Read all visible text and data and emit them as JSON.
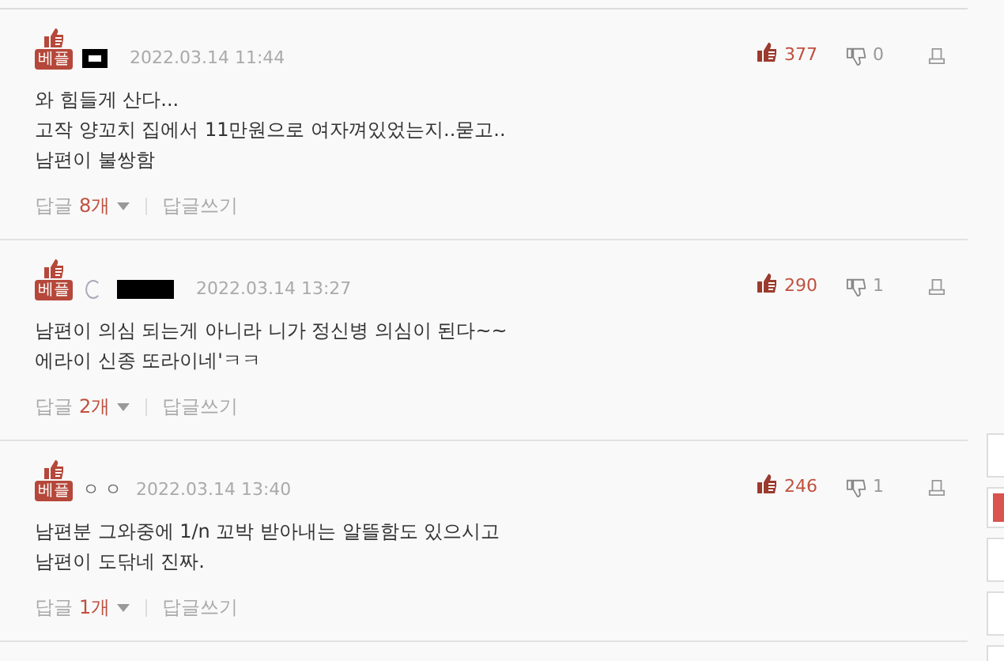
{
  "comments": [
    {
      "badge": "베플",
      "author": {
        "kind": "mask"
      },
      "date": "2022.03.14 11:44",
      "lines": [
        "와 힘들게 산다...",
        "고작 양꼬치 집에서 11만원으로 여자껴있었는지..묻고..",
        "남편이 불쌍함"
      ],
      "likes": "377",
      "dislikes": "0",
      "reply_label": "답글",
      "reply_count": "8개",
      "write_reply": "답글쓰기"
    },
    {
      "badge": "베플",
      "author": {
        "kind": "profile"
      },
      "date": "2022.03.14 13:27",
      "lines": [
        "남편이 의심 되는게 아니라 니가 정신병 의심이 된다~~",
        "에라이 신종 또라이네'ㅋㅋ"
      ],
      "likes": "290",
      "dislikes": "1",
      "reply_label": "답글",
      "reply_count": "2개",
      "write_reply": "답글쓰기"
    },
    {
      "badge": "베플",
      "author": {
        "kind": "name",
        "name": "ㅇㅇ"
      },
      "date": "2022.03.14 13:40",
      "lines": [
        "남편분 그와중에 1/n 꼬박 받아내는 알뜰함도 있으시고",
        "남편이 도닦네 진짜."
      ],
      "likes": "246",
      "dislikes": "1",
      "reply_label": "답글",
      "reply_count": "1개",
      "write_reply": "답글쓰기"
    }
  ]
}
